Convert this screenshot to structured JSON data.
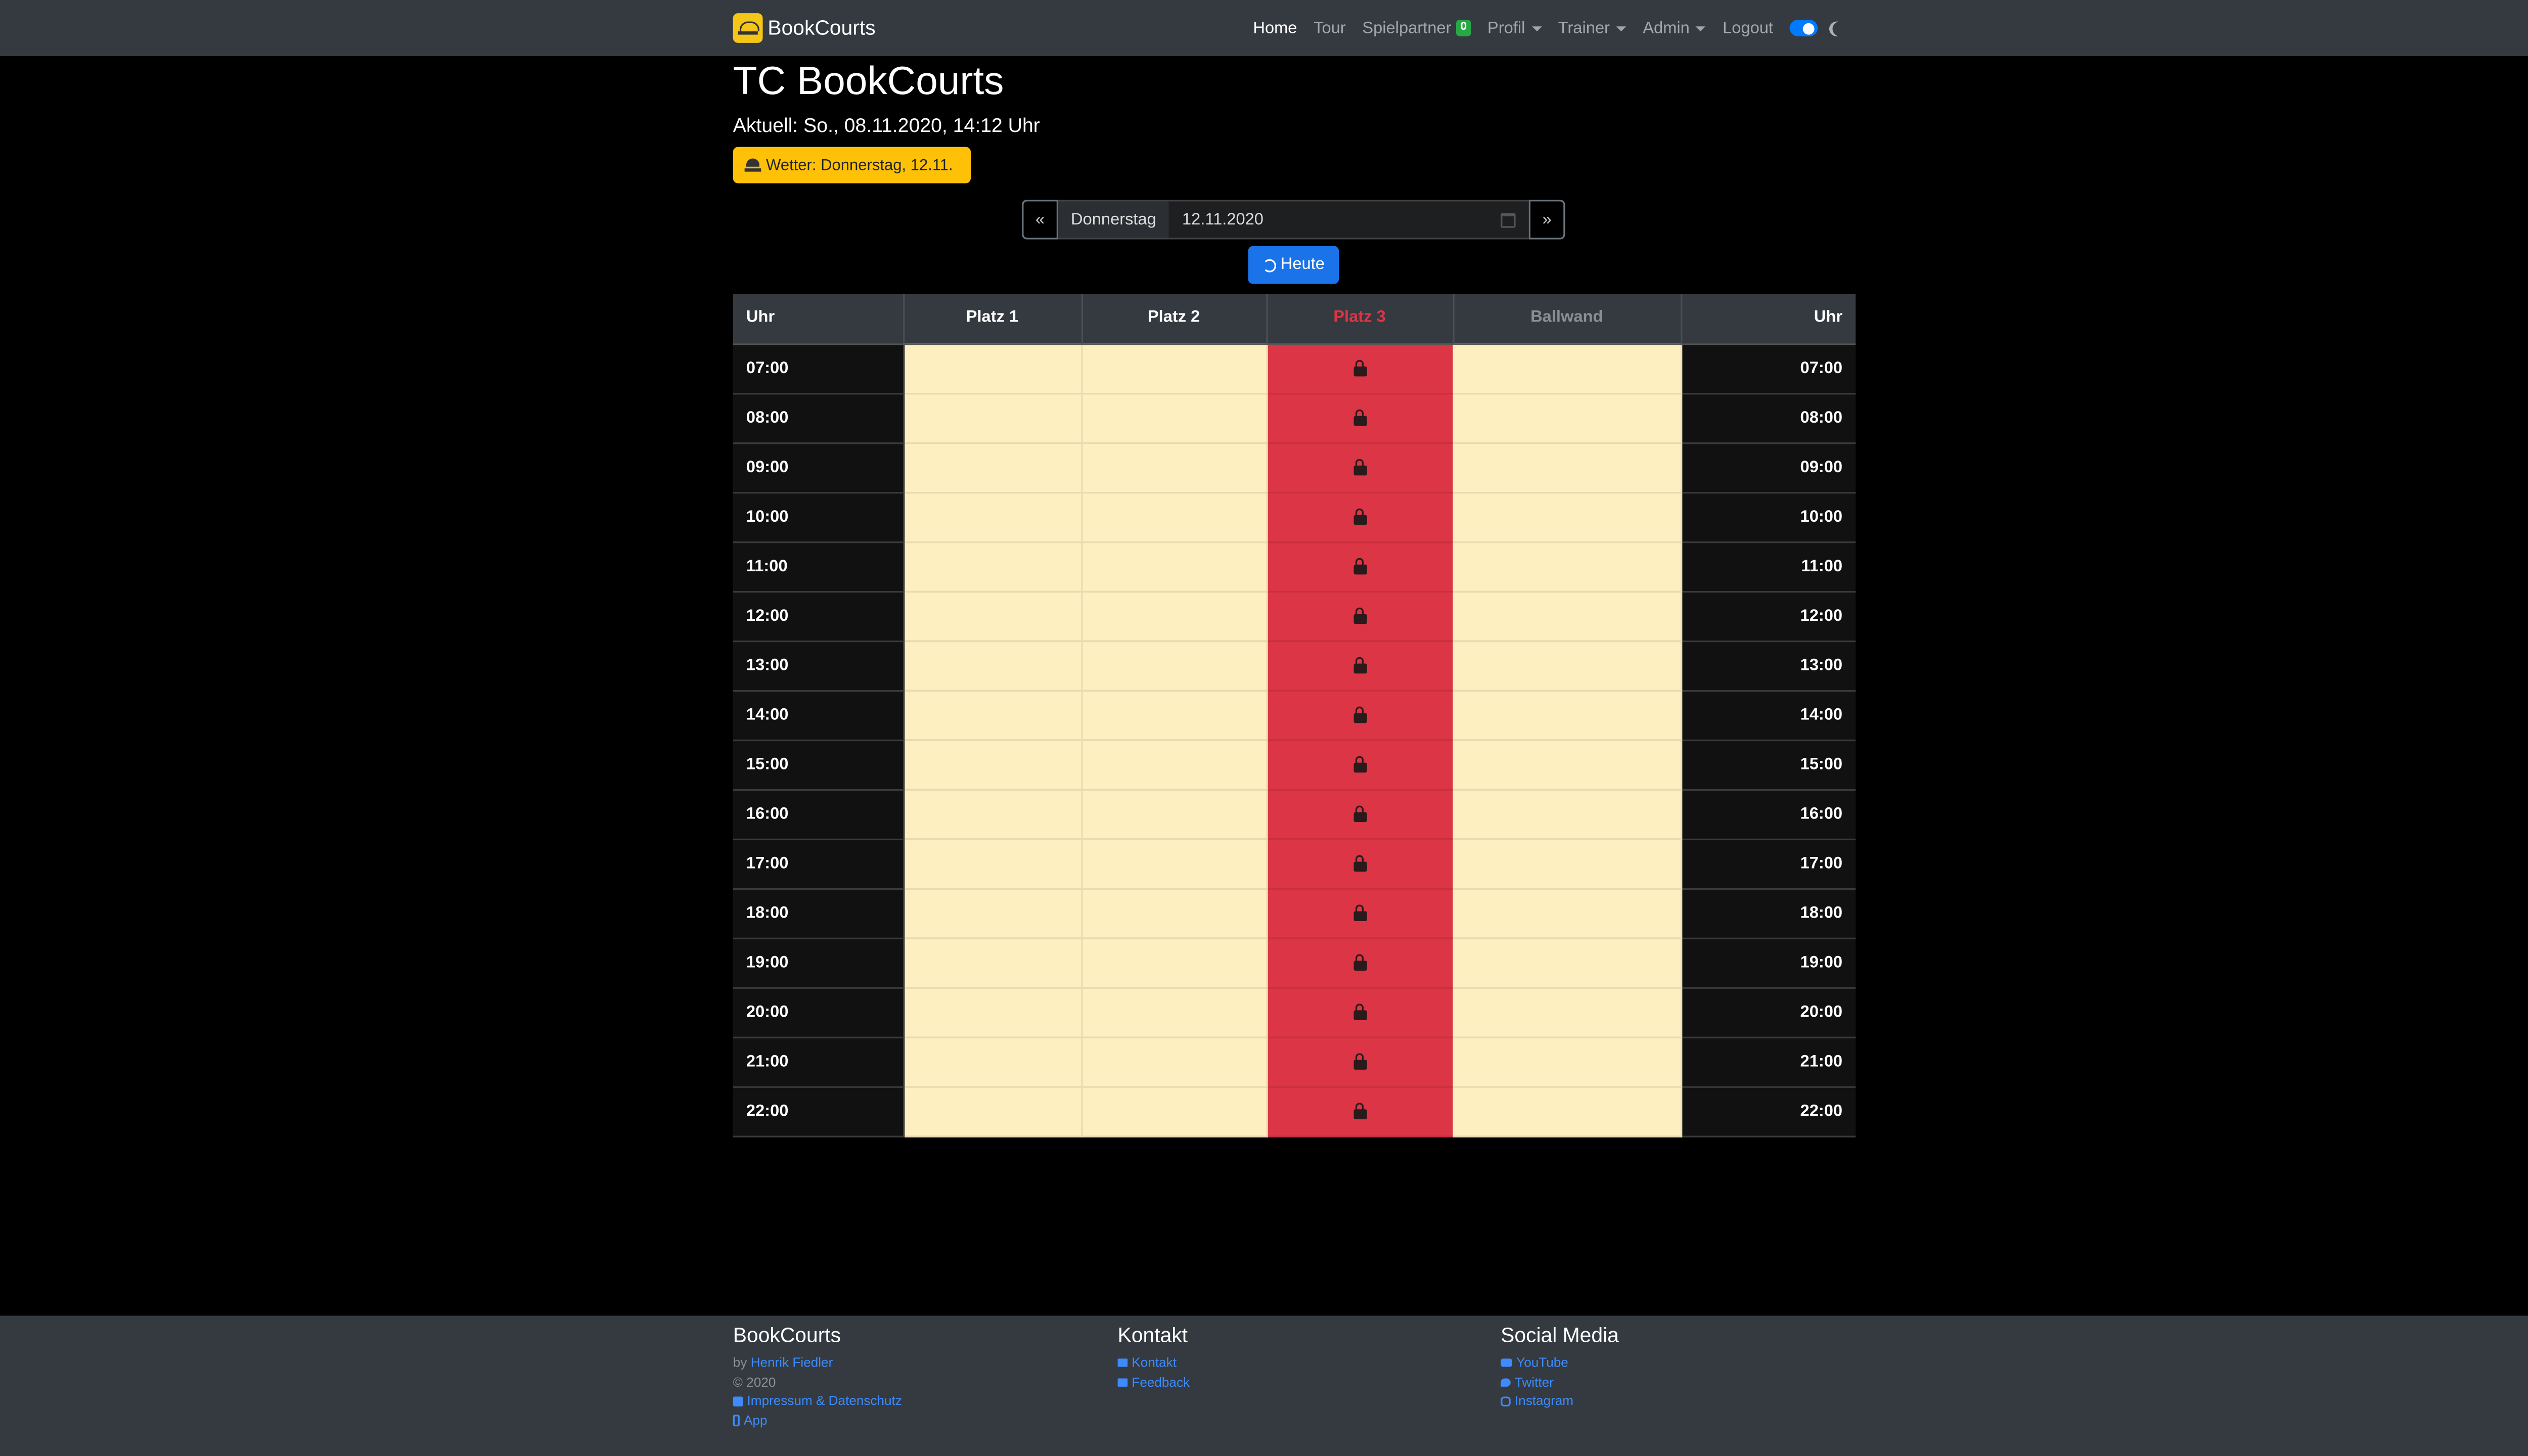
{
  "navbar": {
    "brand": "BookCourts",
    "items": [
      {
        "label": "Home",
        "active": true
      },
      {
        "label": "Tour"
      },
      {
        "label": "Spielpartner",
        "badge": "0"
      },
      {
        "label": "Profil",
        "dropdown": true
      },
      {
        "label": "Trainer",
        "dropdown": true
      },
      {
        "label": "Admin",
        "dropdown": true
      },
      {
        "label": "Logout"
      }
    ],
    "dark_mode_toggle": "on"
  },
  "header": {
    "title": "TC BookCourts",
    "subtitle": "Aktuell: So., 08.11.2020, 14:12 Uhr",
    "weather_button": "Wetter: Donnerstag, 12.11."
  },
  "date_nav": {
    "prev": "«",
    "next": "»",
    "weekday": "Donnerstag",
    "date": "12.11.2020",
    "today_button": "Heute"
  },
  "table": {
    "columns": [
      "Uhr",
      "Platz 1",
      "Platz 2",
      "Platz 3",
      "Ballwand",
      "Uhr"
    ],
    "locked_column": "Platz 3",
    "muted_column": "Ballwand",
    "times": [
      "07:00",
      "08:00",
      "09:00",
      "10:00",
      "11:00",
      "12:00",
      "13:00",
      "14:00",
      "15:00",
      "16:00",
      "17:00",
      "18:00",
      "19:00",
      "20:00",
      "21:00",
      "22:00"
    ]
  },
  "footer": {
    "col1": {
      "title": "BookCourts",
      "by_prefix": "by",
      "author": "Henrik Fiedler",
      "copyright": "© 2020",
      "impressum": "Impressum & Datenschutz",
      "app": "App"
    },
    "col2": {
      "title": "Kontakt",
      "kontakt": "Kontakt",
      "feedback": "Feedback"
    },
    "col3": {
      "title": "Social Media",
      "youtube": "YouTube",
      "twitter": "Twitter",
      "instagram": "Instagram"
    }
  },
  "colors": {
    "navbar_bg": "#343a40",
    "free_slot": "#fdefc0",
    "locked_slot": "#dc3545",
    "weather_button": "#ffc107",
    "primary": "#1a73e8",
    "badge_green": "#28a745"
  }
}
